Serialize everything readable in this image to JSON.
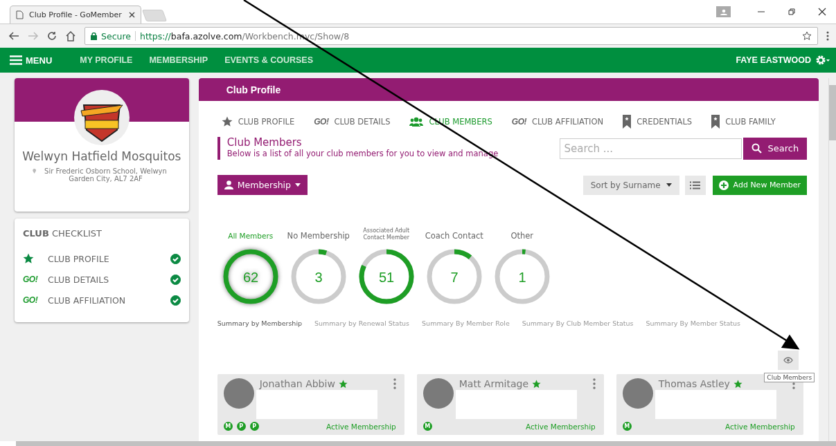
{
  "browser": {
    "tab_title": "Club Profile - GoMember",
    "url": {
      "security": "Secure",
      "scheme": "https://",
      "host": "bafa.azolve.com",
      "path": "/Workbench.mvc/Show/8"
    }
  },
  "nav": {
    "menu": "MENU",
    "items": [
      "MY PROFILE",
      "MEMBERSHIP",
      "EVENTS & COURSES"
    ],
    "user": "FAYE EASTWOOD"
  },
  "club": {
    "name": "Welwyn Hatfield Mosquitos",
    "address": "Sir Frederic Osborn School, Welwyn Garden City, AL7 2AF"
  },
  "checklist": {
    "title_bold": "CLUB",
    "title_rest": "CHECKLIST",
    "items": [
      {
        "kind": "star",
        "label": "CLUB PROFILE",
        "checked": true
      },
      {
        "kind": "go",
        "icon_text": "GO!",
        "label": "CLUB DETAILS",
        "checked": true
      },
      {
        "kind": "go",
        "icon_text": "GO!",
        "label": "CLUB AFFILIATION",
        "checked": true
      }
    ]
  },
  "panel": {
    "title": "Club Profile",
    "tabs": [
      {
        "kind": "star",
        "label": "CLUB PROFILE",
        "selected": false
      },
      {
        "kind": "go",
        "icon_text": "GO!",
        "label": "CLUB DETAILS",
        "selected": false
      },
      {
        "kind": "people",
        "label": "CLUB MEMBERS",
        "selected": true
      },
      {
        "kind": "go",
        "icon_text": "GO!",
        "label": "CLUB AFFILIATION",
        "selected": false
      },
      {
        "kind": "bookmark",
        "label": "CREDENTIALS",
        "selected": false
      },
      {
        "kind": "bookmark",
        "label": "CLUB FAMILY",
        "selected": false
      }
    ],
    "heading": "Club Members",
    "subheading": "Below is a list of all your club members for you to view and manage",
    "search": {
      "placeholder": "Search ...",
      "button": "Search"
    },
    "filter_button": "Membership",
    "sort_button": "Sort by Surname",
    "add_button": "Add New Member",
    "rings": [
      {
        "label": "All Members",
        "value": "62",
        "level": 1,
        "selected": true
      },
      {
        "label": "No Membership",
        "value": "3",
        "level": 0.05,
        "selected": false
      },
      {
        "label": "Associated Adult Contact Member",
        "value": "51",
        "level": 0.82,
        "selected": false
      },
      {
        "label": "Coach Contact",
        "value": "7",
        "level": 0.11,
        "selected": false
      },
      {
        "label": "Other",
        "value": "1",
        "level": 0.02,
        "selected": false
      }
    ],
    "summary_tabs": [
      {
        "label": "Summary by Membership",
        "selected": true
      },
      {
        "label": "Summary by Renewal Status",
        "selected": false
      },
      {
        "label": "Summary By Member Role",
        "selected": false
      },
      {
        "label": "Summary By Club Member Status",
        "selected": false
      },
      {
        "label": "Summary By Member Status",
        "selected": false
      }
    ],
    "view_tooltip": "Club Members",
    "members": [
      {
        "name": "Jonathan Abbiw",
        "starred": true,
        "badges": [
          "M",
          "P",
          "P"
        ],
        "status": "Active Membership"
      },
      {
        "name": "Matt Armitage",
        "starred": true,
        "badges": [
          "M"
        ],
        "status": "Active Membership"
      },
      {
        "name": "Thomas Astley",
        "starred": true,
        "badges": [
          "M"
        ],
        "status": "Active Membership"
      }
    ]
  }
}
